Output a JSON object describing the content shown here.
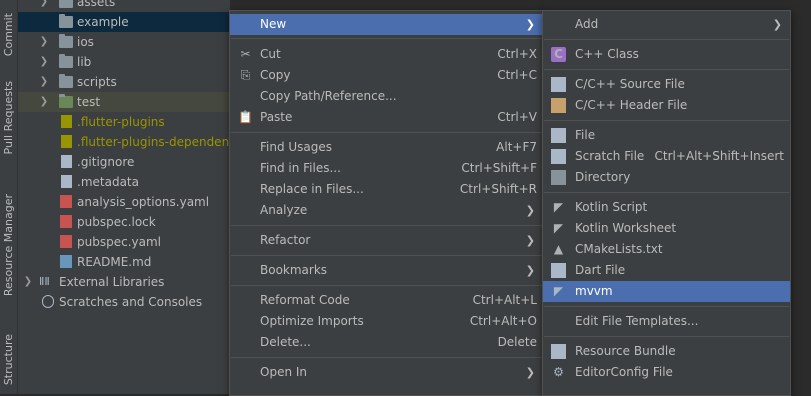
{
  "toolstrip": {
    "tabs": [
      "Commit",
      "Pull Requests",
      "Resource Manager",
      "Structure"
    ]
  },
  "tree": {
    "items": [
      {
        "label": "assets",
        "kind": "folder",
        "depth": 2,
        "expandable": true
      },
      {
        "label": "example",
        "kind": "folder",
        "depth": 2,
        "expandable": false,
        "selected": true
      },
      {
        "label": "ios",
        "kind": "folder",
        "depth": 2,
        "expandable": true
      },
      {
        "label": "lib",
        "kind": "folder",
        "depth": 2,
        "expandable": true
      },
      {
        "label": "scripts",
        "kind": "folder",
        "depth": 2,
        "expandable": true
      },
      {
        "label": "test",
        "kind": "folder",
        "depth": 2,
        "expandable": true,
        "hover": true
      },
      {
        "label": ".flutter-plugins",
        "kind": "file",
        "depth": 2,
        "olive": true
      },
      {
        "label": ".flutter-plugins-dependencies",
        "kind": "file",
        "depth": 2,
        "olive": true
      },
      {
        "label": ".gitignore",
        "kind": "file",
        "depth": 2
      },
      {
        "label": ".metadata",
        "kind": "file",
        "depth": 2
      },
      {
        "label": "analysis_options.yaml",
        "kind": "yaml",
        "depth": 2
      },
      {
        "label": "pubspec.lock",
        "kind": "lock",
        "depth": 2
      },
      {
        "label": "pubspec.yaml",
        "kind": "yaml",
        "depth": 2
      },
      {
        "label": "README.md",
        "kind": "md",
        "depth": 2
      },
      {
        "label": "External Libraries",
        "kind": "libs",
        "depth": 1,
        "expandable": true
      },
      {
        "label": "Scratches and Consoles",
        "kind": "scratch",
        "depth": 1
      }
    ]
  },
  "context_menu": {
    "items": [
      {
        "label": "New",
        "submenu": true,
        "highlighted": true
      },
      {
        "label": "Cut",
        "shortcut": "Ctrl+X",
        "icon": "scissors-icon"
      },
      {
        "label": "Copy",
        "shortcut": "Ctrl+C",
        "icon": "copy-icon"
      },
      {
        "label": "Copy Path/Reference..."
      },
      {
        "label": "Paste",
        "shortcut": "Ctrl+V",
        "icon": "paste-icon"
      },
      {
        "sep": true
      },
      {
        "label": "Find Usages",
        "shortcut": "Alt+F7"
      },
      {
        "label": "Find in Files...",
        "shortcut": "Ctrl+Shift+F"
      },
      {
        "label": "Replace in Files...",
        "shortcut": "Ctrl+Shift+R"
      },
      {
        "label": "Analyze",
        "submenu": true
      },
      {
        "sep": true
      },
      {
        "label": "Refactor",
        "submenu": true
      },
      {
        "sep": true
      },
      {
        "label": "Bookmarks",
        "submenu": true
      },
      {
        "sep": true
      },
      {
        "label": "Reformat Code",
        "shortcut": "Ctrl+Alt+L"
      },
      {
        "label": "Optimize Imports",
        "shortcut": "Ctrl+Alt+O"
      },
      {
        "label": "Delete...",
        "shortcut": "Delete"
      },
      {
        "sep": true
      },
      {
        "label": "Open In",
        "submenu": true
      }
    ]
  },
  "new_submenu": {
    "items": [
      {
        "label": "Add",
        "submenu": true
      },
      {
        "sep": true
      },
      {
        "label": "C++ Class",
        "icon": "cpp-class-icon"
      },
      {
        "sep": true
      },
      {
        "label": "C/C++ Source File",
        "icon": "cpp-source-file-icon"
      },
      {
        "label": "C/C++ Header File",
        "icon": "cpp-header-file-icon"
      },
      {
        "sep": true
      },
      {
        "label": "File",
        "icon": "file-icon"
      },
      {
        "label": "Scratch File",
        "shortcut": "Ctrl+Alt+Shift+Insert",
        "icon": "scratch-file-icon"
      },
      {
        "label": "Directory",
        "icon": "directory-icon"
      },
      {
        "sep": true
      },
      {
        "label": "Kotlin Script",
        "icon": "kotlin-icon"
      },
      {
        "label": "Kotlin Worksheet",
        "icon": "kotlin-icon"
      },
      {
        "label": "CMakeLists.txt",
        "icon": "cmake-icon"
      },
      {
        "label": "Dart File",
        "icon": "dart-file-icon"
      },
      {
        "label": "mvvm",
        "icon": "template-icon",
        "highlighted": true
      },
      {
        "sep": true
      },
      {
        "label": "Edit File Templates..."
      },
      {
        "sep": true
      },
      {
        "label": "Resource Bundle",
        "icon": "resource-bundle-icon"
      },
      {
        "label": "EditorConfig File",
        "icon": "editorconfig-icon"
      }
    ]
  }
}
